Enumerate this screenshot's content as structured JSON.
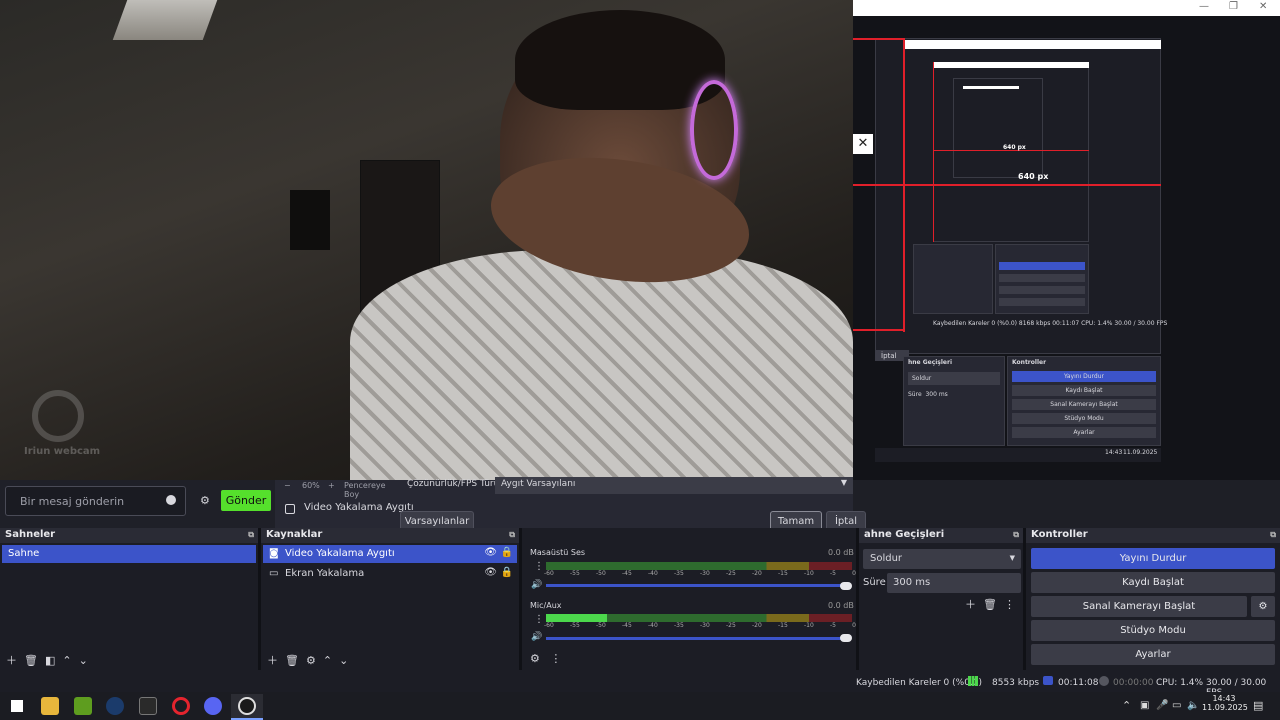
{
  "camera": {
    "watermark": "Iriun webcam"
  },
  "preview": {
    "label_640_small": "640 px",
    "label_640_large": "640 px",
    "mini_stats": "Kaybedilen Kareler 0 (%0.0)   8168 kbps   00:11:07   CPU: 1.4%   30.00 / 30.00 FPS",
    "mini_clock": "14:43",
    "mini_date": "11.09.2025",
    "mini_transitions_title": "hne Geçişleri",
    "mini_controls_title": "Kontroller",
    "mini_transition": "Soldur",
    "mini_duration_label": "Süre",
    "mini_duration": "300 ms",
    "mini_iptal": "İptal",
    "mini_ctrls": [
      "Yayını Durdur",
      "Kaydı Başlat",
      "Sanal Kamerayı Başlat",
      "Stüdyo Modu",
      "Ayarlar"
    ]
  },
  "chat": {
    "placeholder": "Bir mesaj gönderin",
    "send": "Gönder"
  },
  "dialog": {
    "zoom_minus": "−",
    "zoom_value": "60%",
    "zoom_plus": "+",
    "fit_label": "Pencereye Boy",
    "device_source": "Video Yakalama Aygıtı",
    "res_label": "Çözünürlük/FPS Türü",
    "res_value": "Aygıt Varsayılanı",
    "defaults_btn": "Varsayılanlar",
    "ok_btn": "Tamam",
    "cancel_btn": "İptal"
  },
  "scenes": {
    "title": "Sahneler",
    "items": [
      "Sahne"
    ]
  },
  "sources": {
    "title": "Kaynaklar",
    "items": [
      "Video Yakalama Aygıtı",
      "Ekran Yakalama"
    ]
  },
  "mixer": {
    "channels": [
      {
        "name": "Masaüstü Ses",
        "db": "0.0 dB",
        "level": 0
      },
      {
        "name": "Mic/Aux",
        "db": "0.0 dB",
        "level": 0.2
      }
    ],
    "scale": [
      "-60",
      "-55",
      "-50",
      "-45",
      "-40",
      "-35",
      "-30",
      "-25",
      "-20",
      "-15",
      "-10",
      "-5",
      "0"
    ]
  },
  "transitions": {
    "title": "ahne Geçişleri",
    "type": "Soldur",
    "duration_label": "Süre",
    "duration": "300 ms"
  },
  "controls": {
    "title": "Kontroller",
    "buttons": [
      "Yayını Durdur",
      "Kaydı Başlat",
      "Sanal Kamerayı Başlat",
      "Stüdyo Modu",
      "Ayarlar"
    ]
  },
  "status": {
    "dropped": "Kaybedilen Kareler 0 (%0.0)",
    "bitrate": "8553 kbps",
    "stream_time": "00:11:08",
    "rec_time": "00:00:00",
    "cpu": "CPU: 1.4%",
    "fps": "30.00 / 30.00 FPS"
  },
  "taskbar": {
    "time": "14:43",
    "date": "11.09.2025"
  },
  "colors": {
    "accent": "#3c54c9",
    "send": "#55e02c",
    "red_guide": "#e01f2a"
  }
}
